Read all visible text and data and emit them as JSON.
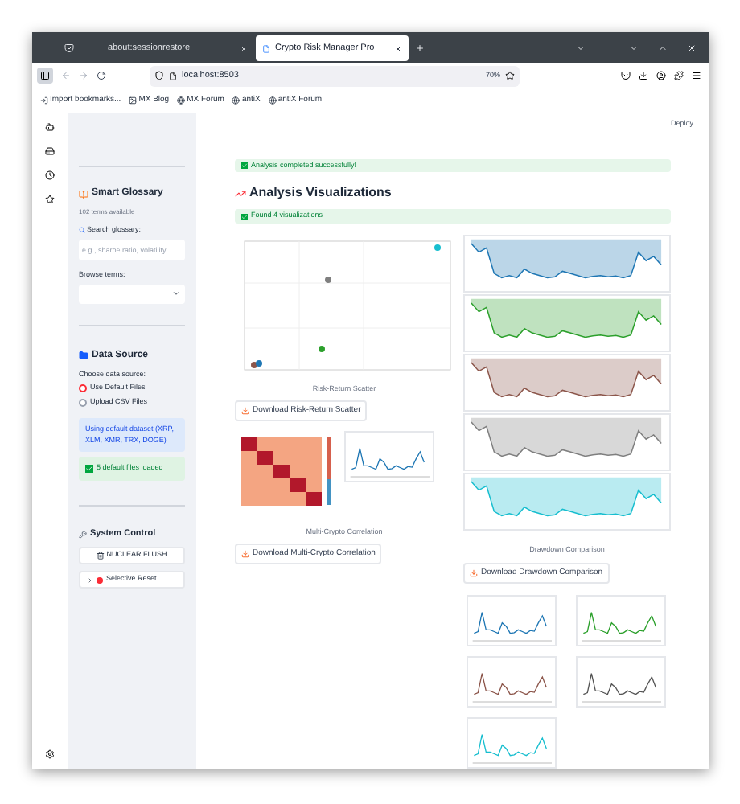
{
  "tabs": [
    {
      "label": "about:sessionrestore",
      "selected": false
    },
    {
      "label": "Crypto Risk Manager Pro",
      "selected": true
    }
  ],
  "url": "localhost:8503",
  "zoom": "70%",
  "bookmarks": [
    {
      "label": "Import bookmarks...",
      "kind": "import"
    },
    {
      "label": "MX Blog",
      "kind": "image"
    },
    {
      "label": "MX Forum",
      "kind": "globe"
    },
    {
      "label": "antiX",
      "kind": "globe"
    },
    {
      "label": "antiX Forum",
      "kind": "globe"
    }
  ],
  "sidebar": {
    "glossary": {
      "title": "Smart Glossary",
      "count": "102 terms available",
      "search_label": "Search glossary:",
      "placeholder": "e.g., sharpe ratio, volatility...",
      "browse_label": "Browse terms:"
    },
    "data_source": {
      "title": "Data Source",
      "prompt": "Choose data source:",
      "options": [
        {
          "label": "Use Default Files",
          "selected": true
        },
        {
          "label": "Upload CSV Files",
          "selected": false
        }
      ],
      "info": "Using default dataset (XRP, XLM, XMR, TRX, DOGE)",
      "success": "5 default files loaded"
    },
    "system_control": {
      "title": "System Control",
      "flush_button": "NUCLEAR FLUSH",
      "reset_expander": {
        "label": "Selective Reset",
        "expanded": false
      }
    }
  },
  "main": {
    "deploy": "Deploy",
    "status": "Analysis completed successfully!",
    "heading": "Analysis Visualizations",
    "found": "Found 4 visualizations",
    "scatter": {
      "caption": "Risk-Return Scatter",
      "button": "Download Risk-Return Scatter"
    },
    "correlation": {
      "caption": "Multi-Crypto Correlation",
      "button": "Download Multi-Crypto Correlation"
    },
    "drawdown": {
      "caption": "Drawdown Comparison",
      "button": "Download Drawdown Comparison",
      "series": [
        {
          "color": "#1f77b4"
        },
        {
          "color": "#2ca02c"
        },
        {
          "color": "#8c564b"
        },
        {
          "color": "#7f7f7f"
        },
        {
          "color": "#17becf"
        }
      ]
    },
    "price_charts": [
      {
        "color": "#1f77b4"
      },
      {
        "color": "#2ca02c"
      },
      {
        "color": "#8c564b"
      },
      {
        "color": "#555555"
      },
      {
        "color": "#17becf"
      }
    ]
  }
}
